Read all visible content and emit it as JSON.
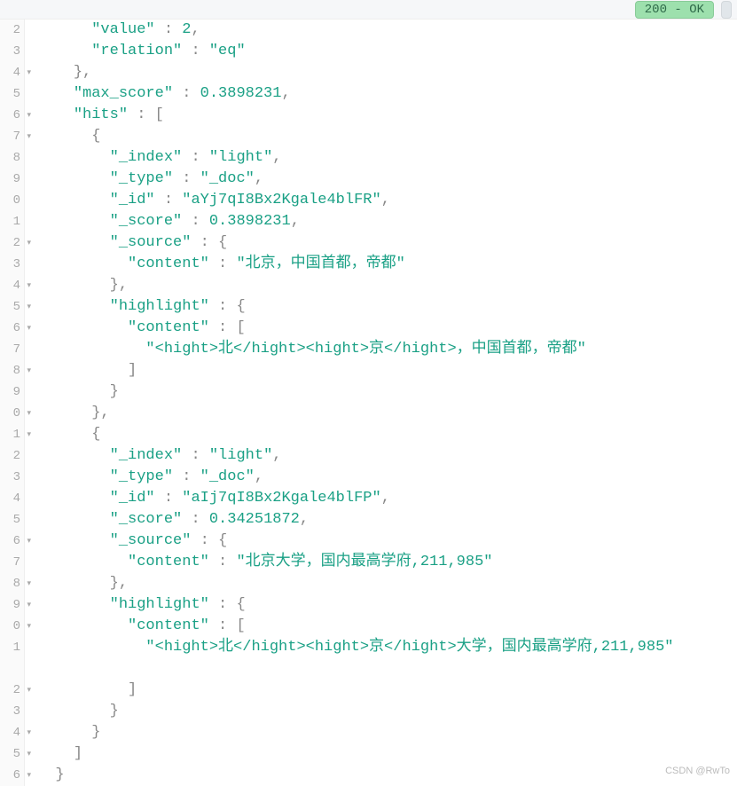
{
  "status_badge": "200 - OK",
  "gutter": {
    "lines": [
      "2",
      "3",
      "4",
      "5",
      "6",
      "7",
      "8",
      "9",
      "0",
      "1",
      "2",
      "3",
      "4",
      "5",
      "6",
      "7",
      "8",
      "9",
      "0",
      "1",
      "2",
      "3",
      "4",
      "5",
      "6",
      "7",
      "8",
      "9",
      "0",
      "1",
      "2",
      "3",
      "4",
      "5",
      "6"
    ],
    "folds": [
      false,
      false,
      true,
      false,
      true,
      true,
      false,
      false,
      false,
      false,
      true,
      false,
      true,
      true,
      true,
      false,
      true,
      false,
      true,
      true,
      false,
      false,
      false,
      false,
      true,
      false,
      true,
      true,
      true,
      false,
      true,
      false,
      true,
      true,
      true
    ]
  },
  "code": {
    "l0_k": "\"value\"",
    "l0_p": " : ",
    "l0_v": "2",
    "l0_e": ",",
    "l1_k": "\"relation\"",
    "l1_p": " : ",
    "l1_v": "\"eq\"",
    "l2": "},",
    "l3_k": "\"max_score\"",
    "l3_p": " : ",
    "l3_v": "0.3898231",
    "l3_e": ",",
    "l4_k": "\"hits\"",
    "l4_p": " : [",
    "l5": "{",
    "l6_k": "\"_index\"",
    "l6_p": " : ",
    "l6_v": "\"light\"",
    "l6_e": ",",
    "l7_k": "\"_type\"",
    "l7_p": " : ",
    "l7_v": "\"_doc\"",
    "l7_e": ",",
    "l8_k": "\"_id\"",
    "l8_p": " : ",
    "l8_v": "\"aYj7qI8Bx2Kgale4blFR\"",
    "l8_e": ",",
    "l9_k": "\"_score\"",
    "l9_p": " : ",
    "l9_v": "0.3898231",
    "l9_e": ",",
    "l10_k": "\"_source\"",
    "l10_p": " : {",
    "l11_k": "\"content\"",
    "l11_p": " : ",
    "l11_v": "\"北京，中国首都，帝都\"",
    "l12": "},",
    "l13_k": "\"highlight\"",
    "l13_p": " : {",
    "l14_k": "\"content\"",
    "l14_p": " : [",
    "l15_v": "\"<hight>北</hight><hight>京</hight>，中国首都，帝都\"",
    "l16": "]",
    "l17": "}",
    "l18": "},",
    "l19": "{",
    "l20_k": "\"_index\"",
    "l20_p": " : ",
    "l20_v": "\"light\"",
    "l20_e": ",",
    "l21_k": "\"_type\"",
    "l21_p": " : ",
    "l21_v": "\"_doc\"",
    "l21_e": ",",
    "l22_k": "\"_id\"",
    "l22_p": " : ",
    "l22_v": "\"aIj7qI8Bx2Kgale4blFP\"",
    "l22_e": ",",
    "l23_k": "\"_score\"",
    "l23_p": " : ",
    "l23_v": "0.34251872",
    "l23_e": ",",
    "l24_k": "\"_source\"",
    "l24_p": " : {",
    "l25_k": "\"content\"",
    "l25_p": " : ",
    "l25_v": "\"北京大学，国内最高学府,211,985\"",
    "l26": "},",
    "l27_k": "\"highlight\"",
    "l27_p": " : {",
    "l28_k": "\"content\"",
    "l28_p": " : [",
    "l29_v": "\"<hight>北</hight><hight>京</hight>大学，国内最高学府,211,985\"",
    "l30": "]",
    "l31": "}",
    "l32": "}",
    "l33": "]",
    "l34": "}"
  },
  "watermark": "CSDN @RwTo"
}
